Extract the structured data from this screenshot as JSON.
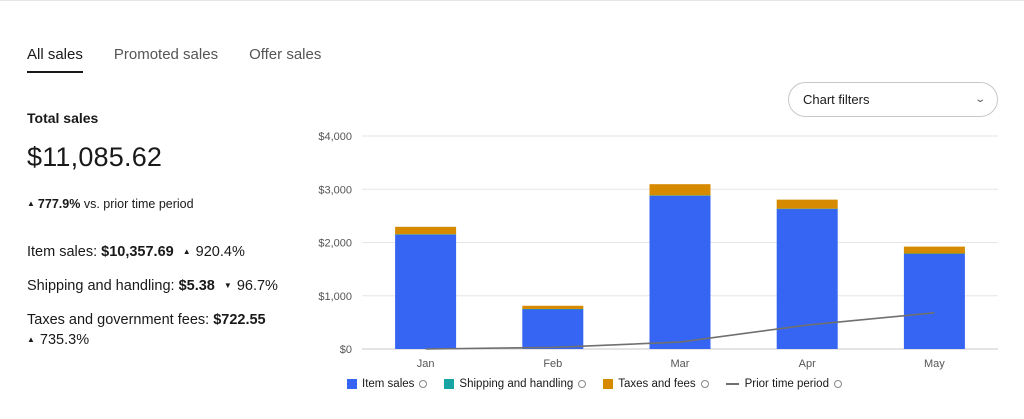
{
  "tabs": [
    {
      "label": "All sales",
      "active": true
    },
    {
      "label": "Promoted sales",
      "active": false
    },
    {
      "label": "Offer sales",
      "active": false
    }
  ],
  "summary": {
    "total_label": "Total sales",
    "total_value": "$11,085.62",
    "change_pct": "777.9%",
    "change_text": "vs. prior time period",
    "item_sales_label": "Item sales:",
    "item_sales_value": "$10,357.69",
    "item_sales_pct": "920.4%",
    "shipping_label": "Shipping and handling:",
    "shipping_value": "$5.38",
    "shipping_pct": "96.7%",
    "taxes_label": "Taxes and government fees:",
    "taxes_value": "$722.55",
    "taxes_pct": "735.3%"
  },
  "filters": {
    "label": "Chart filters"
  },
  "legend": {
    "item_sales": "Item sales",
    "shipping": "Shipping and handling",
    "taxes": "Taxes and fees",
    "prior": "Prior time period"
  },
  "colors": {
    "item_sales": "#3665f3",
    "shipping": "#1aa3a3",
    "taxes": "#d68a00",
    "prior": "#707070",
    "grid": "#e6e6e6"
  },
  "chart_data": {
    "type": "bar",
    "stacked": true,
    "categories": [
      "Jan",
      "Feb",
      "Mar",
      "Apr",
      "May"
    ],
    "y_ticks": [
      "$0",
      "$1,000",
      "$2,000",
      "$3,000",
      "$4,000"
    ],
    "ylim": [
      0,
      4000
    ],
    "series": [
      {
        "name": "Item sales",
        "values": [
          2150,
          750,
          2880,
          2630,
          1790
        ]
      },
      {
        "name": "Shipping and handling",
        "values": [
          5,
          2,
          5,
          5,
          3
        ]
      },
      {
        "name": "Taxes and fees",
        "values": [
          140,
          60,
          210,
          170,
          130
        ]
      }
    ],
    "line": {
      "name": "Prior time period",
      "values": [
        0,
        30,
        130,
        450,
        680
      ]
    },
    "grid": true,
    "legend_position": "bottom"
  }
}
